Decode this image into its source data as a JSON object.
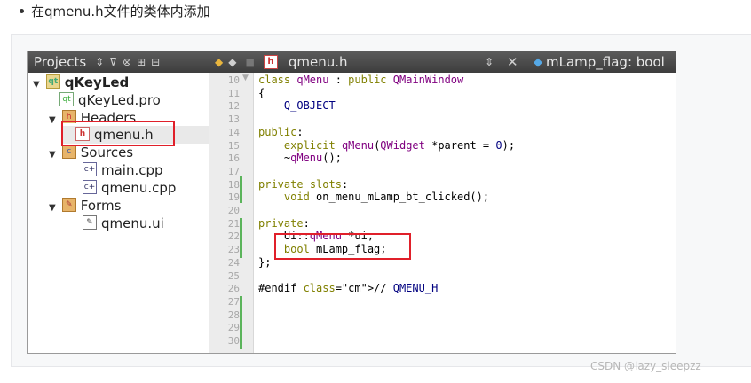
{
  "intro": {
    "text": "在qmenu.h文件的类体内添加"
  },
  "toolbar": {
    "projects_title": "Projects",
    "up_down_icon": "updown-arrows-icon",
    "filter_icon": "filter-icon",
    "link_icon": "link-icon",
    "split_icon": "split-icon",
    "close_pane_icon": "close-pane-icon",
    "file_name": "qmenu.h",
    "symbol": "mLamp_flag: bool"
  },
  "tree": {
    "items": [
      {
        "label": "qKeyLed",
        "type": "project"
      },
      {
        "label": "qKeyLed.pro",
        "type": "pro"
      },
      {
        "label": "Headers",
        "type": "folder-headers"
      },
      {
        "label": "qmenu.h",
        "type": "header"
      },
      {
        "label": "Sources",
        "type": "folder-sources"
      },
      {
        "label": "main.cpp",
        "type": "cpp"
      },
      {
        "label": "qmenu.cpp",
        "type": "cpp"
      },
      {
        "label": "Forms",
        "type": "folder-forms"
      },
      {
        "label": "qmenu.ui",
        "type": "ui"
      }
    ]
  },
  "editor": {
    "line_numbers": [
      "10",
      "11",
      "12",
      "13",
      "14",
      "15",
      "16",
      "17",
      "18",
      "19",
      "20",
      "21",
      "22",
      "23",
      "24",
      "25",
      "26",
      "27",
      "28",
      "29",
      "30"
    ],
    "lines": [
      "class qMenu : public QMainWindow",
      "{",
      "    Q_OBJECT",
      "",
      "public:",
      "    explicit qMenu(QWidget *parent = 0);",
      "    ~qMenu();",
      "",
      "private slots:",
      "    void on_menu_mLamp_bt_clicked();",
      "",
      "private:",
      "    Ui::qMenu *ui;",
      "    bool mLamp_flag;",
      "};",
      "",
      "#endif // QMENU_H",
      "",
      "",
      "",
      ""
    ]
  },
  "watermark": "CSDN @lazy_sleepzz"
}
